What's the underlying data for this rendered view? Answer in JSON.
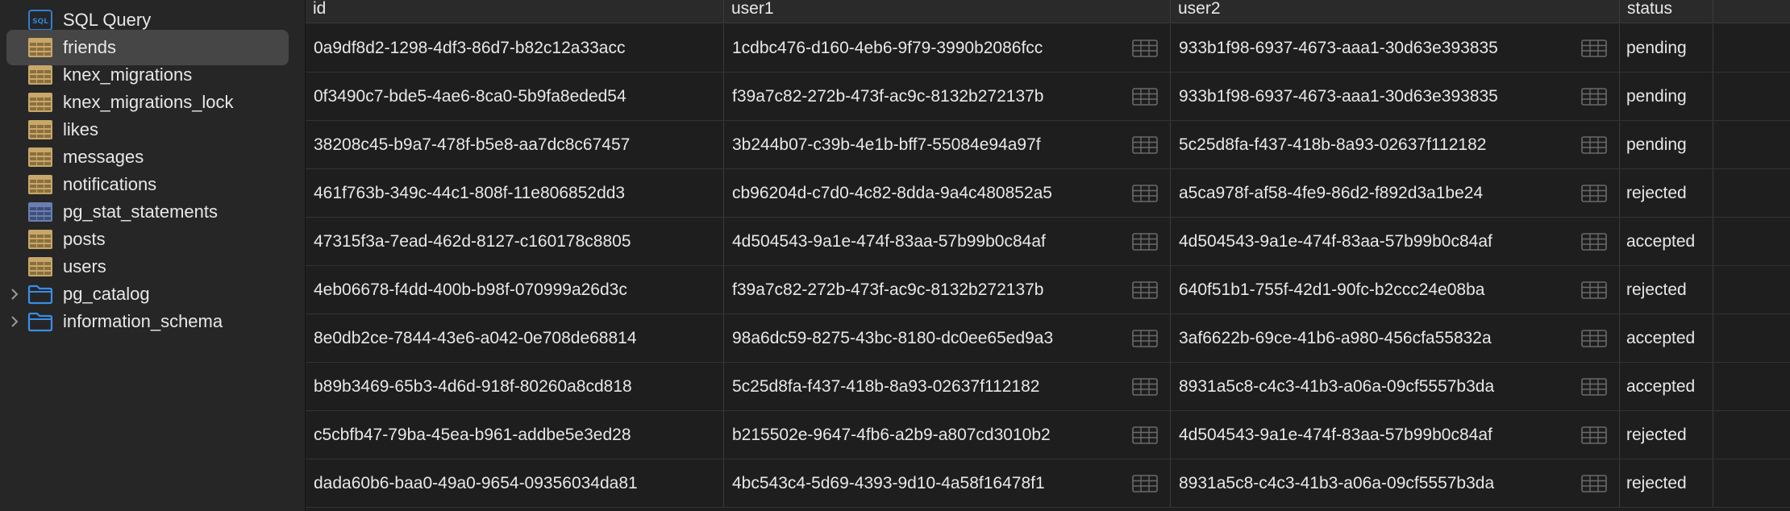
{
  "sidebar": {
    "items": [
      {
        "label": "SQL Query",
        "icon": "sql-icon"
      },
      {
        "label": "friends",
        "icon": "table-icon",
        "selected": true
      },
      {
        "label": "knex_migrations",
        "icon": "table-icon"
      },
      {
        "label": "knex_migrations_lock",
        "icon": "table-icon"
      },
      {
        "label": "likes",
        "icon": "table-icon"
      },
      {
        "label": "messages",
        "icon": "table-icon"
      },
      {
        "label": "notifications",
        "icon": "table-icon"
      },
      {
        "label": "pg_stat_statements",
        "icon": "view-icon"
      },
      {
        "label": "posts",
        "icon": "table-icon"
      },
      {
        "label": "users",
        "icon": "table-icon"
      },
      {
        "label": "pg_catalog",
        "icon": "folder-icon",
        "expandable": true
      },
      {
        "label": "information_schema",
        "icon": "folder-icon",
        "expandable": true
      }
    ]
  },
  "table": {
    "columns": [
      "id",
      "user1",
      "user2",
      "status"
    ],
    "rows": [
      [
        "0a9df8d2-1298-4df3-86d7-b82c12a33acc",
        "1cdbc476-d160-4eb6-9f79-3990b2086fcc",
        "933b1f98-6937-4673-aaa1-30d63e393835",
        "pending"
      ],
      [
        "0f3490c7-bde5-4ae6-8ca0-5b9fa8eded54",
        "f39a7c82-272b-473f-ac9c-8132b272137b",
        "933b1f98-6937-4673-aaa1-30d63e393835",
        "pending"
      ],
      [
        "38208c45-b9a7-478f-b5e8-aa7dc8c67457",
        "3b244b07-c39b-4e1b-bff7-55084e94a97f",
        "5c25d8fa-f437-418b-8a93-02637f112182",
        "pending"
      ],
      [
        "461f763b-349c-44c1-808f-11e806852dd3",
        "cb96204d-c7d0-4c82-8dda-9a4c480852a5",
        "a5ca978f-af58-4fe9-86d2-f892d3a1be24",
        "rejected"
      ],
      [
        "47315f3a-7ead-462d-8127-c160178c8805",
        "4d504543-9a1e-474f-83aa-57b99b0c84af",
        "4d504543-9a1e-474f-83aa-57b99b0c84af",
        "accepted"
      ],
      [
        "4eb06678-f4dd-400b-b98f-070999a26d3c",
        "f39a7c82-272b-473f-ac9c-8132b272137b",
        "640f51b1-755f-42d1-90fc-b2ccc24e08ba",
        "rejected"
      ],
      [
        "8e0db2ce-7844-43e6-a042-0e708de68814",
        "98a6dc59-8275-43bc-8180-dc0ee65ed9a3",
        "3af6622b-69ce-41b6-a980-456cfa55832a",
        "accepted"
      ],
      [
        "b89b3469-65b3-4d6d-918f-80260a8cd818",
        "5c25d8fa-f437-418b-8a93-02637f112182",
        "8931a5c8-c4c3-41b3-a06a-09cf5557b3da",
        "accepted"
      ],
      [
        "c5cbfb47-79ba-45ea-b961-addbe5e3ed28",
        "b215502e-9647-4fb6-a2b9-a807cd3010b2",
        "4d504543-9a1e-474f-83aa-57b99b0c84af",
        "rejected"
      ],
      [
        "dada60b6-baa0-49a0-9654-09356034da81",
        "4bc543c4-5d69-4393-9d10-4a58f16478f1",
        "8931a5c8-c4c3-41b3-a06a-09cf5557b3da",
        "rejected"
      ]
    ]
  },
  "colors": {
    "background": "#1e1e1e",
    "sidebar": "#262626",
    "selected": "#464646",
    "table_icon": "#c9a76a",
    "folder_icon": "#3a8ee6",
    "sql_icon": "#2f7fd6"
  }
}
